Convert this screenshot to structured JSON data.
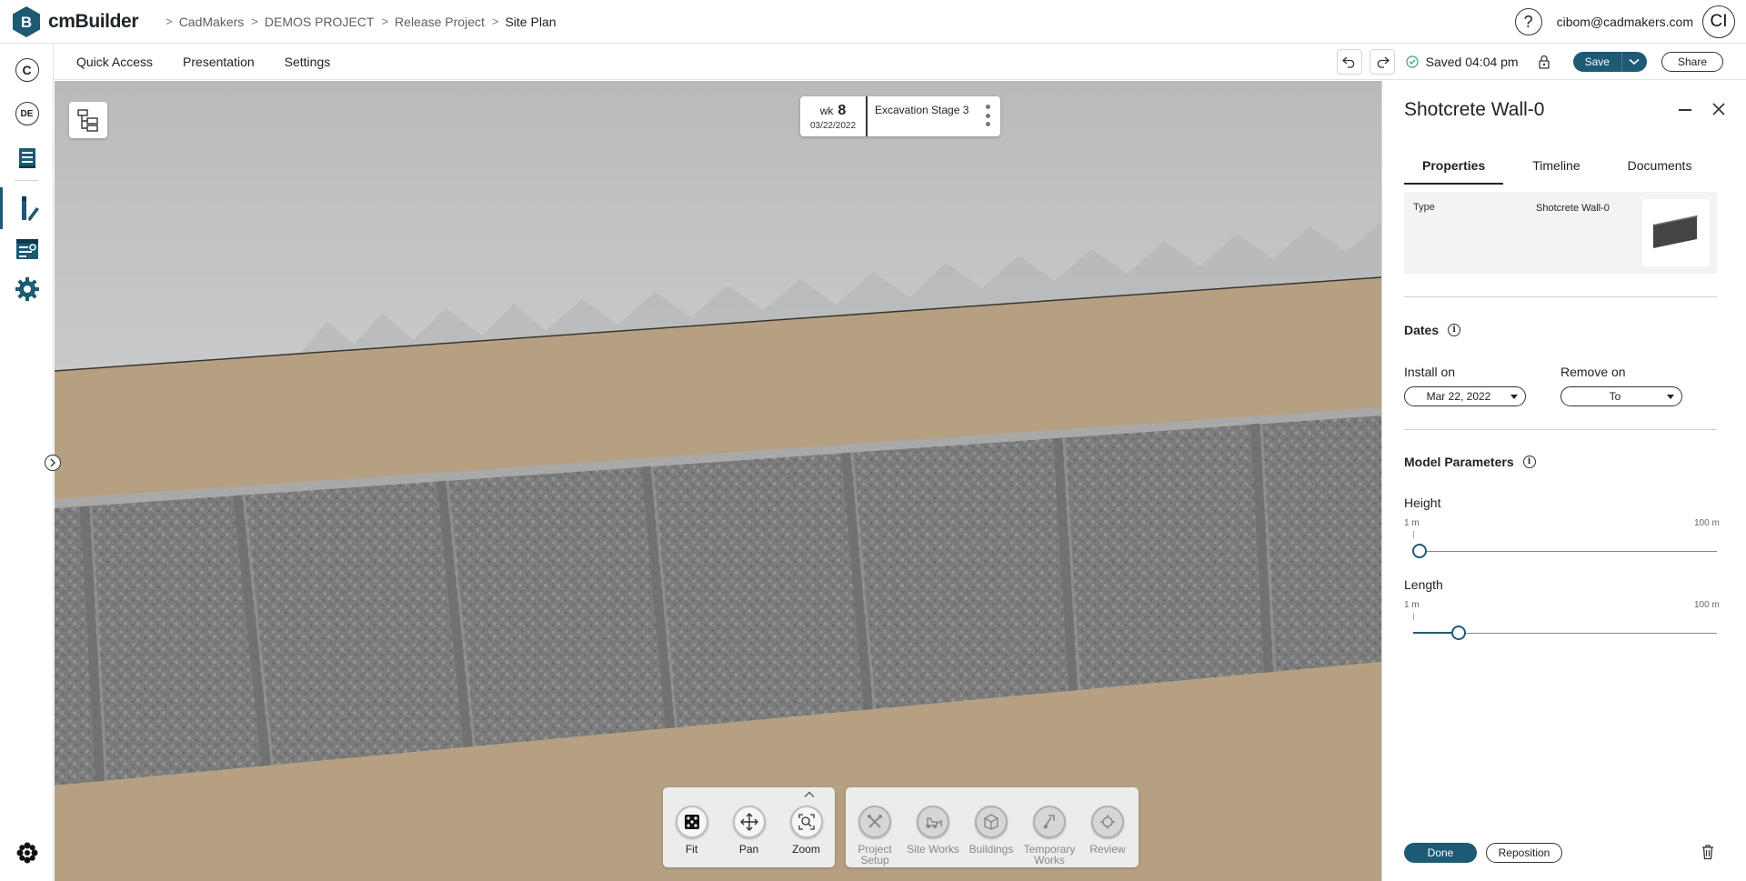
{
  "app": {
    "name": "cmBuilder",
    "logo_letter": "B"
  },
  "breadcrumb": [
    "CadMakers",
    "DEMOS PROJECT",
    "Release Project",
    "Site Plan"
  ],
  "header": {
    "help_symbol": "?",
    "user_email": "cibom@cadmakers.com",
    "user_initials": "CI"
  },
  "leftrail": {
    "company_initial": "C",
    "project_initials": "DE",
    "items": [
      {
        "icon": "document-stack-icon"
      },
      {
        "icon": "design-pencil-icon",
        "active": true
      },
      {
        "icon": "schedule-calendar-icon"
      },
      {
        "icon": "gear-icon"
      }
    ],
    "bottom_icon": "app-grid-icon"
  },
  "toolbar": {
    "menu": [
      "Quick Access",
      "Presentation",
      "Settings"
    ],
    "saved_status": "Saved 04:04 pm",
    "save_label": "Save",
    "share_label": "Share"
  },
  "viewport": {
    "week_prefix": "wk",
    "week_number": "8",
    "week_date": "03/22/2022",
    "stage_name": "Excavation Stage 3",
    "nav_tools": [
      {
        "label": "Fit",
        "icon": "fit-dice-icon"
      },
      {
        "label": "Pan",
        "icon": "pan-arrows-icon"
      },
      {
        "label": "Zoom",
        "icon": "zoom-box-icon"
      }
    ],
    "category_tools": [
      {
        "label": "Project Setup",
        "icon": "project-setup-icon"
      },
      {
        "label": "Site Works",
        "icon": "site-works-icon"
      },
      {
        "label": "Buildings",
        "icon": "buildings-icon"
      },
      {
        "label": "Temporary Works",
        "icon": "temporary-works-icon"
      },
      {
        "label": "Review",
        "icon": "review-icon"
      }
    ]
  },
  "panel": {
    "title": "Shotcrete Wall-0",
    "tabs": [
      "Properties",
      "Timeline",
      "Documents"
    ],
    "active_tab": "Properties",
    "type_label": "Type",
    "type_value": "Shotcrete Wall-0",
    "dates_title": "Dates",
    "install_label": "Install on",
    "install_value": "Mar 22, 2022",
    "remove_label": "Remove on",
    "remove_value": "To",
    "model_params_title": "Model Parameters",
    "height_label": "Height",
    "height_min": "1 m",
    "height_max": "100 m",
    "height_fraction": 0.02,
    "length_label": "Length",
    "length_min": "1 m",
    "length_max": "100 m",
    "length_fraction": 0.15,
    "done_label": "Done",
    "reposition_label": "Reposition"
  },
  "colors": {
    "accent": "#1d5a74",
    "sand": "#b6a082",
    "concrete": "#7d7d7d",
    "sky": "#c8c9cb"
  }
}
